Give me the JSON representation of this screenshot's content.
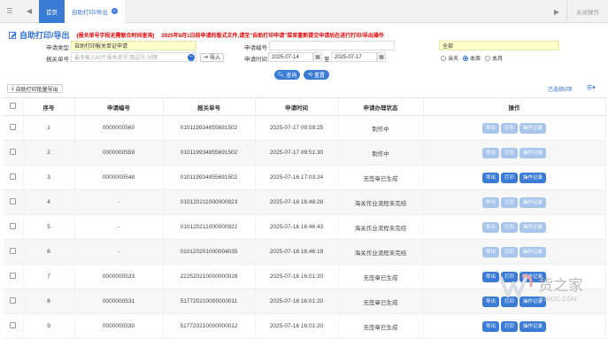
{
  "tabs": {
    "home_label": "首页",
    "active_label": "自助打印/导出",
    "close_label": "关闭操作"
  },
  "page": {
    "title": "自助打印/导出",
    "note1": "(报关单号字段无需联合时间查询)",
    "note2": "2025年8月1日前申请的版式文件,请至“自助打印申请”菜单重新提交申请后在进行打印/导出操作"
  },
  "form": {
    "apply_type_label": "申请类型",
    "apply_type_value": "自助打印报关单证申请",
    "apply_no_label": "申请编号",
    "apply_status_label": "申请状态",
    "apply_status_value": "全部",
    "decl_no_label": "报关单号",
    "decl_no_placeholder": "最多输入50个报关单号,用逗号,分隔",
    "import_label": "导入",
    "apply_time_label": "申请时间",
    "date_from": "2025-07-14",
    "date_sep": "至",
    "date_to": "2025-07-17",
    "radio_today": "当天",
    "radio_week": "本周",
    "radio_month": "本月",
    "search_label": "查询",
    "reset_label": "重置"
  },
  "toolbar": {
    "batch_label": "自助打印批量导出",
    "selected_count": "已选择0项"
  },
  "table": {
    "headers": [
      "序号",
      "申请编号",
      "报关单号",
      "申请时间",
      "申请办理状态",
      "操作"
    ],
    "action_labels": [
      "导出",
      "打印",
      "操作记录"
    ],
    "rows": [
      {
        "no": "1",
        "apply_no": "0000000560",
        "decl_no": "010119934855691502",
        "time": "2025-07-17 09:59:25",
        "status": "制作中"
      },
      {
        "no": "2",
        "apply_no": "0000000559",
        "decl_no": "010119934855691502",
        "time": "2025-07-17 09:51:30",
        "status": "制作中"
      },
      {
        "no": "3",
        "apply_no": "0000000548",
        "decl_no": "010119934855691502",
        "time": "2025-07-16 17:03:24",
        "status": "无签章已生成"
      },
      {
        "no": "4",
        "apply_no": "-",
        "decl_no": "010120211000000923",
        "time": "2025-07-16 16:48:28",
        "status": "海关作业流程未完结"
      },
      {
        "no": "5",
        "apply_no": "-",
        "decl_no": "010120211000000922",
        "time": "2025-07-16 16:46:43",
        "status": "海关作业流程未完结"
      },
      {
        "no": "6",
        "apply_no": "-",
        "decl_no": "010120201000004035",
        "time": "2025-07-16 16:46:19",
        "status": "海关作业流程未完结"
      },
      {
        "no": "7",
        "apply_no": "0000000533",
        "decl_no": "222520210000000028",
        "time": "2025-07-16 16:01:20",
        "status": "无签章已生成"
      },
      {
        "no": "8",
        "apply_no": "0000000531",
        "decl_no": "517720210000000011",
        "time": "2025-07-16 16:01:20",
        "status": "无签章已生成"
      },
      {
        "no": "9",
        "apply_no": "0000000530",
        "decl_no": "517720210000000012",
        "time": "2025-07-16 16:01:20",
        "status": "无签章已生成"
      }
    ]
  },
  "watermark": {
    "text": "货之家",
    "url": "51W2C.COM"
  }
}
